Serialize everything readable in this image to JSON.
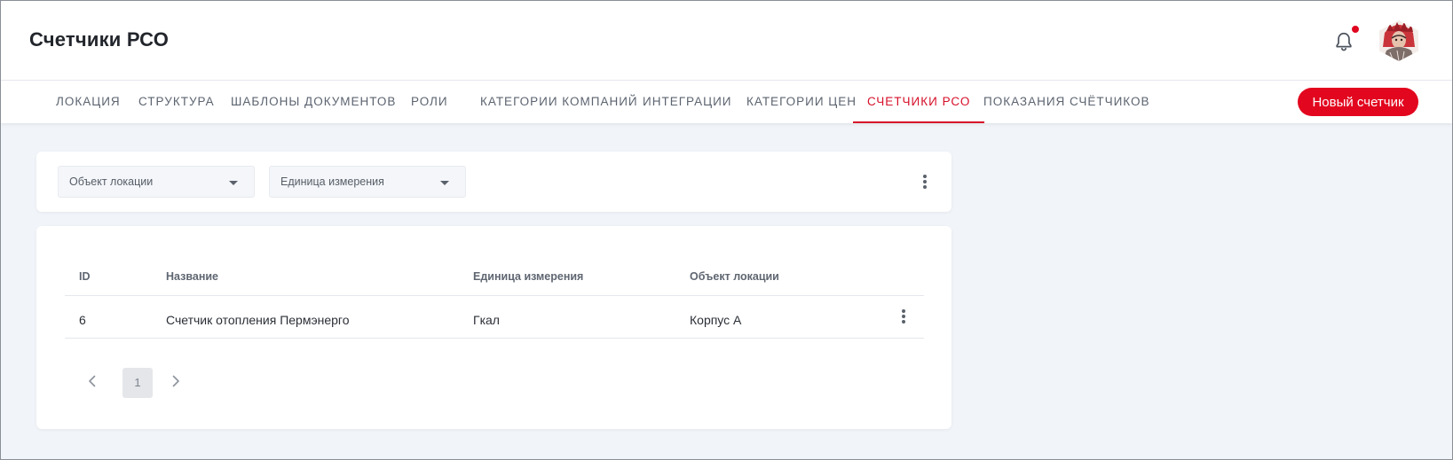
{
  "header": {
    "title": "Счетчики РСО"
  },
  "tabs": [
    {
      "label": "ЛОКАЦИЯ"
    },
    {
      "label": "СТРУКТУРА"
    },
    {
      "label": "ШАБЛОНЫ ДОКУМЕНТОВ"
    },
    {
      "label": "РОЛИ"
    },
    {
      "label": "КАТЕГОРИИ КОМПАНИЙ"
    },
    {
      "label": "ИНТЕГРАЦИИ"
    },
    {
      "label": "КАТЕГОРИИ ЦЕН"
    },
    {
      "label": "СЧЕТЧИКИ РСО",
      "active": true
    },
    {
      "label": "ПОКАЗАНИЯ СЧЁТЧИКОВ"
    }
  ],
  "toolbar": {
    "new_button_label": "Новый счетчик"
  },
  "filters": {
    "location_object": {
      "placeholder": "Объект локации"
    },
    "unit": {
      "placeholder": "Единица измерения"
    }
  },
  "table": {
    "columns": [
      "ID",
      "Название",
      "Единица измерения",
      "Объект локации"
    ],
    "rows": [
      {
        "id": "6",
        "name": "Счетчик отопления Пермэнерго",
        "unit": "Гкал",
        "location": "Корпус А"
      }
    ]
  },
  "pagination": {
    "current_page": "1"
  },
  "colors": {
    "accent": "#e2061e",
    "active_tab": "#d6102a",
    "background": "#f1f4f8"
  },
  "icons": {
    "notifications": "bell-icon",
    "menu": "more-vertical-icon",
    "prev": "chevron-left-icon",
    "next": "chevron-right-icon",
    "dropdown": "caret-down-icon"
  }
}
